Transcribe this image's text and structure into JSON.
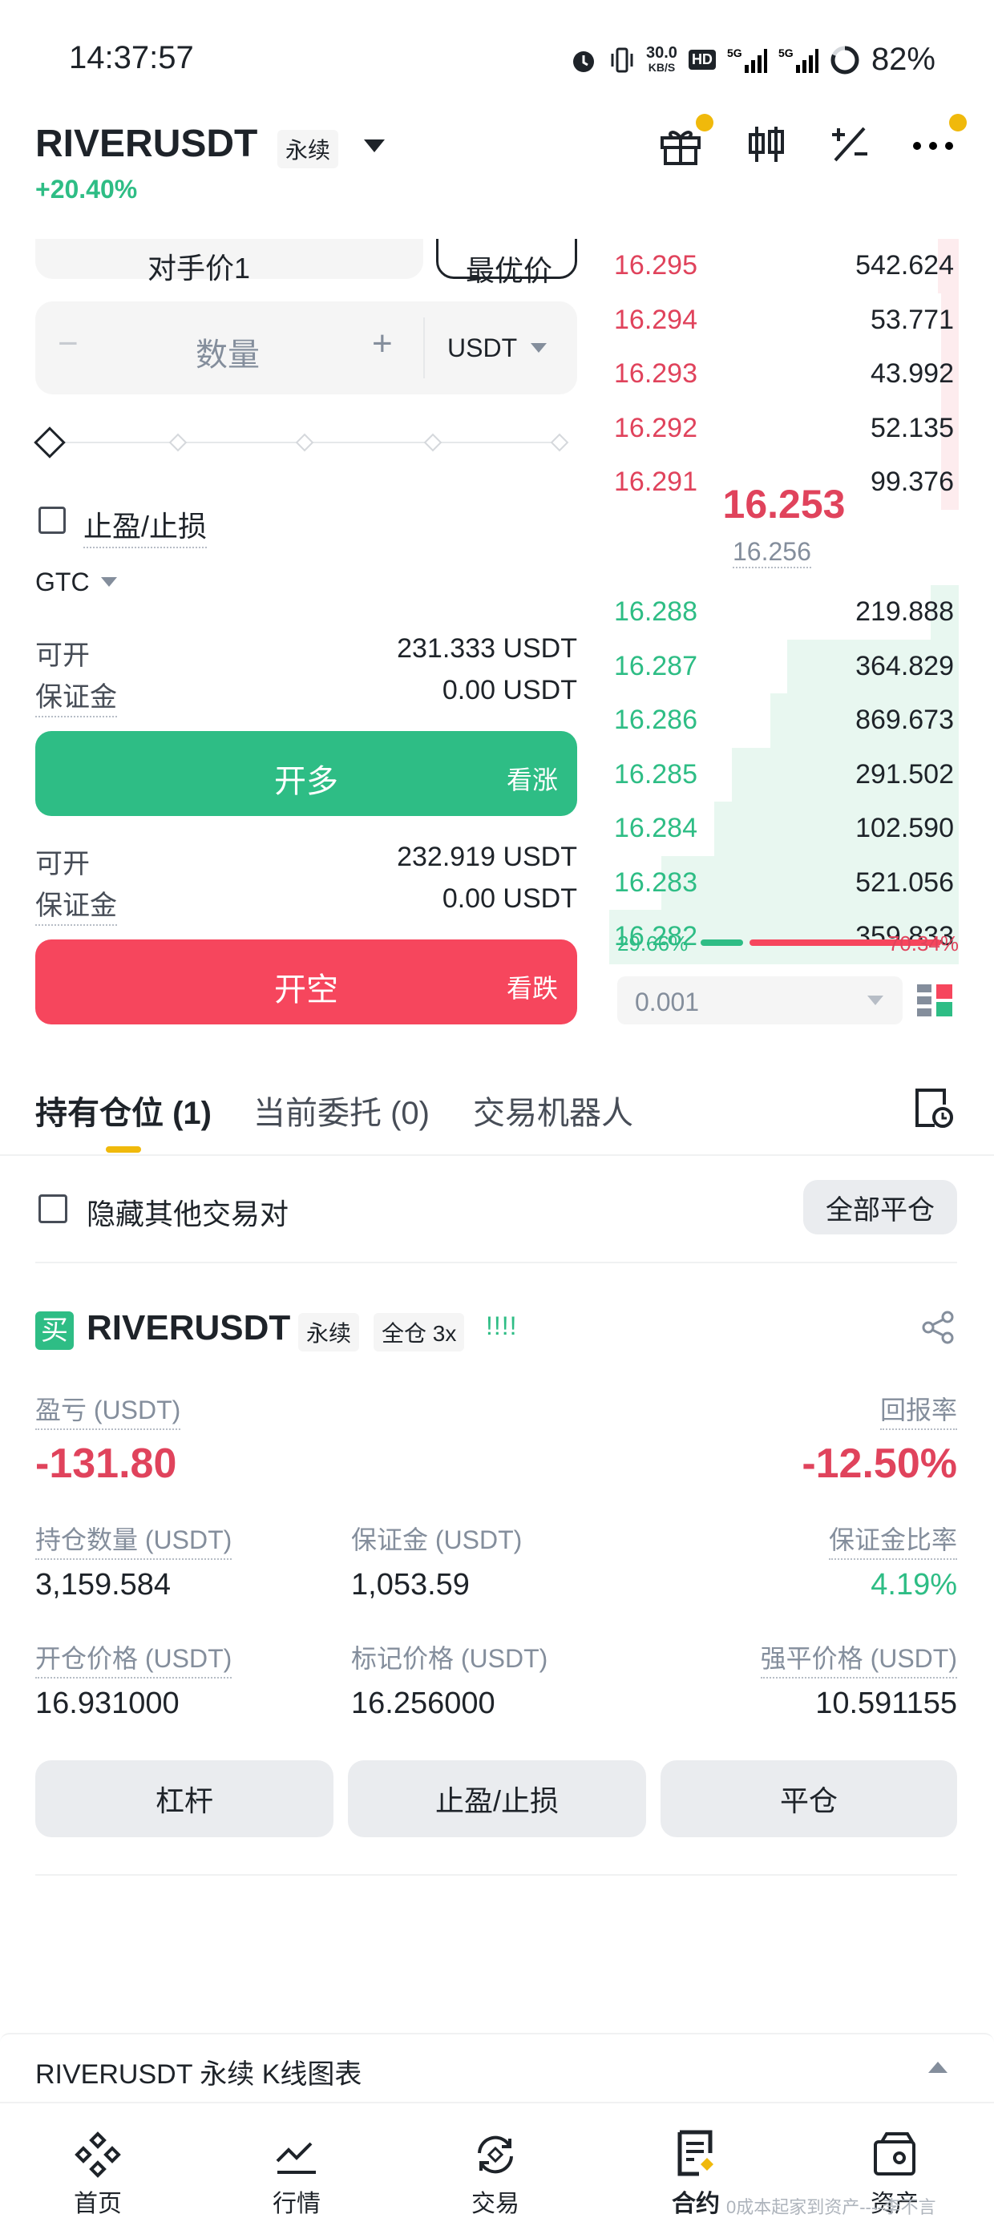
{
  "status": {
    "time": "14:37:57",
    "net_speed_top": "30.0",
    "net_speed_unit": "KB/S",
    "hd": "HD",
    "sig1": "5G",
    "sig2": "5G",
    "battery": "82%"
  },
  "header": {
    "symbol": "RIVERUSDT",
    "tag": "永续",
    "change": "+20.40%"
  },
  "order": {
    "price_type": "对手价1",
    "best_price": "最优价",
    "qty_placeholder": "数量",
    "unit": "USDT",
    "tpsl": "止盈/止损",
    "tif": "GTC",
    "long": {
      "avail_label": "可开",
      "avail": "231.333 USDT",
      "margin_label": "保证金",
      "margin": "0.00 USDT",
      "btn": "开多",
      "btn_sub": "看涨"
    },
    "short": {
      "avail_label": "可开",
      "avail": "232.919 USDT",
      "margin_label": "保证金",
      "margin": "0.00 USDT",
      "btn": "开空",
      "btn_sub": "看跌"
    }
  },
  "book": {
    "asks": [
      {
        "p": "16.295",
        "q": "542.624",
        "depth": 0.06
      },
      {
        "p": "16.294",
        "q": "53.771",
        "depth": 0.05
      },
      {
        "p": "16.293",
        "q": "43.992",
        "depth": 0.05
      },
      {
        "p": "16.292",
        "q": "52.135",
        "depth": 0.05
      },
      {
        "p": "16.291",
        "q": "99.376",
        "depth": 0.05
      }
    ],
    "last": "16.253",
    "mark": "16.256",
    "bids": [
      {
        "p": "16.288",
        "q": "219.888",
        "depth": 0.08
      },
      {
        "p": "16.287",
        "q": "364.829",
        "depth": 0.49
      },
      {
        "p": "16.286",
        "q": "869.673",
        "depth": 0.54
      },
      {
        "p": "16.285",
        "q": "291.502",
        "depth": 0.65
      },
      {
        "p": "16.284",
        "q": "102.590",
        "depth": 0.7
      },
      {
        "p": "16.283",
        "q": "521.056",
        "depth": 0.85
      },
      {
        "p": "16.282",
        "q": "359.833",
        "depth": 1.0
      }
    ],
    "buy_pct": "29.66%",
    "sell_pct": "70.34%",
    "buy_ratio": 0.2966,
    "tick": "0.001"
  },
  "tabs": {
    "positions": "持有仓位 (1)",
    "orders": "当前委托 (0)",
    "bots": "交易机器人"
  },
  "filter": {
    "hide_others": "隐藏其他交易对",
    "close_all": "全部平仓"
  },
  "position": {
    "side": "买",
    "symbol": "RIVERUSDT",
    "tag1": "永续",
    "tag2": "全仓 3x",
    "bars": "!!!!",
    "pnl_label": "盈亏 (USDT)",
    "pnl": "-131.80",
    "roe_label": "回报率",
    "roe": "-12.50%",
    "size_label": "持仓数量 (USDT)",
    "size": "3,159.584",
    "margin_label": "保证金 (USDT)",
    "margin": "1,053.59",
    "ratio_label": "保证金比率",
    "ratio": "4.19%",
    "entry_label": "开仓价格 (USDT)",
    "entry": "16.931000",
    "mark_label": "标记价格 (USDT)",
    "mark": "16.256000",
    "liq_label": "强平价格 (USDT)",
    "liq": "10.591155",
    "btn_leverage": "杠杆",
    "btn_tpsl": "止盈/止损",
    "btn_close": "平仓"
  },
  "kline": {
    "label": "RIVERUSDT 永续 K线图表"
  },
  "nav": {
    "home": "首页",
    "markets": "行情",
    "trade": "交易",
    "futures": "合约",
    "assets": "资产"
  },
  "watermark": "0成本起家到资产----李不言",
  "colors": {
    "green": "#2ebd85",
    "red": "#f6465d",
    "accent": "#f0b90b"
  }
}
